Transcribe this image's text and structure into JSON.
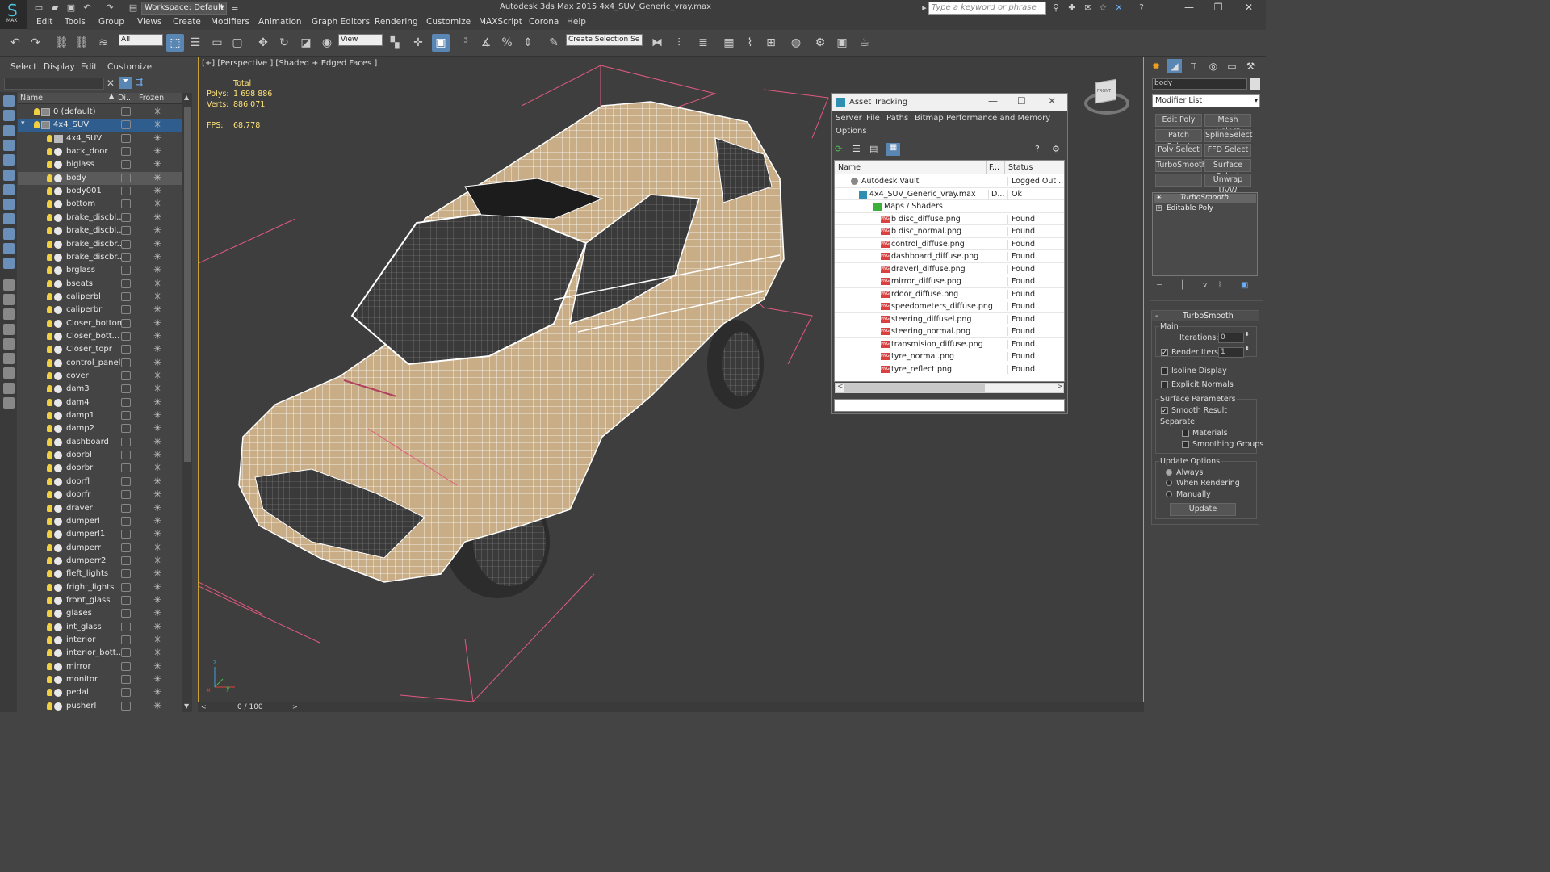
{
  "app": {
    "title": "Autodesk 3ds Max  2015    4x4_SUV_Generic_vray.max",
    "logo": "MAX",
    "workspace": "Workspace: Default",
    "search_placeholder": "Type a keyword or phrase"
  },
  "menu": [
    "Edit",
    "Tools",
    "Group",
    "Views",
    "Create",
    "Modifiers",
    "Animation",
    "Graph Editors",
    "Rendering",
    "Customize",
    "MAXScript",
    "Corona",
    "Help"
  ],
  "toolbar": {
    "filter": "All",
    "refcoord": "View",
    "selset": "Create Selection Se"
  },
  "scene": {
    "tabs": [
      "Select",
      "Display",
      "Edit",
      "Customize"
    ],
    "columns": {
      "name": "Name",
      "display": "Di...",
      "frozen": "Frozen"
    },
    "rows": [
      {
        "label": "0 (default)",
        "type": "layer"
      },
      {
        "label": "4x4_SUV",
        "type": "layer",
        "selected": true
      },
      {
        "label": "4x4_SUV",
        "type": "group"
      },
      {
        "label": "back_door"
      },
      {
        "label": "blglass"
      },
      {
        "label": "body",
        "highlight": true
      },
      {
        "label": "body001"
      },
      {
        "label": "bottom"
      },
      {
        "label": "brake_discbl..."
      },
      {
        "label": "brake_discbl..."
      },
      {
        "label": "brake_discbr..."
      },
      {
        "label": "brake_discbr..."
      },
      {
        "label": "brglass"
      },
      {
        "label": "bseats"
      },
      {
        "label": "caliperbl"
      },
      {
        "label": "caliperbr"
      },
      {
        "label": "Closer_bottoml"
      },
      {
        "label": "Closer_bott..."
      },
      {
        "label": "Closer_topr"
      },
      {
        "label": "control_panel"
      },
      {
        "label": "cover"
      },
      {
        "label": "dam3"
      },
      {
        "label": "dam4"
      },
      {
        "label": "damp1"
      },
      {
        "label": "damp2"
      },
      {
        "label": "dashboard"
      },
      {
        "label": "doorbl"
      },
      {
        "label": "doorbr"
      },
      {
        "label": "doorfl"
      },
      {
        "label": "doorfr"
      },
      {
        "label": "draver"
      },
      {
        "label": "dumperl"
      },
      {
        "label": "dumperl1"
      },
      {
        "label": "dumperr"
      },
      {
        "label": "dumperr2"
      },
      {
        "label": "fleft_lights"
      },
      {
        "label": "fright_lights"
      },
      {
        "label": "front_glass"
      },
      {
        "label": "glases"
      },
      {
        "label": "int_glass"
      },
      {
        "label": "interior"
      },
      {
        "label": "interior_bott..."
      },
      {
        "label": "mirror"
      },
      {
        "label": "monitor"
      },
      {
        "label": "pedal"
      },
      {
        "label": "pusherl"
      }
    ]
  },
  "viewport": {
    "label": "[+] [Perspective ] [Shaded + Edged Faces ]",
    "stats": {
      "total": "Total",
      "polys_label": "Polys:",
      "polys": "1 698 886",
      "verts_label": "Verts:",
      "verts": "886 071",
      "fps_label": "FPS:",
      "fps": "68,778"
    },
    "timeline": "0 / 100",
    "viewcube": "FRONT"
  },
  "asset": {
    "title": "Asset Tracking",
    "menu": [
      "Server",
      "File",
      "Paths",
      "Bitmap Performance and Memory",
      "Options"
    ],
    "columns": {
      "name": "Name",
      "f": "F...",
      "status": "Status"
    },
    "rows": [
      {
        "name": "Autodesk Vault",
        "f": "",
        "status": "Logged Out ...",
        "level": 0,
        "icon": "vault"
      },
      {
        "name": "4x4_SUV_Generic_vray.max",
        "f": "D...",
        "status": "Ok",
        "level": 1,
        "icon": "max"
      },
      {
        "name": "Maps / Shaders",
        "f": "",
        "status": "",
        "level": 2,
        "icon": "maps"
      },
      {
        "name": "b disc_diffuse.png",
        "f": "",
        "status": "Found",
        "level": 3,
        "icon": "png"
      },
      {
        "name": "b disc_normal.png",
        "f": "",
        "status": "Found",
        "level": 3,
        "icon": "png"
      },
      {
        "name": "control_diffuse.png",
        "f": "",
        "status": "Found",
        "level": 3,
        "icon": "png"
      },
      {
        "name": "dashboard_diffuse.png",
        "f": "",
        "status": "Found",
        "level": 3,
        "icon": "png"
      },
      {
        "name": "draverl_diffuse.png",
        "f": "",
        "status": "Found",
        "level": 3,
        "icon": "png"
      },
      {
        "name": "mirror_diffuse.png",
        "f": "",
        "status": "Found",
        "level": 3,
        "icon": "png"
      },
      {
        "name": "rdoor_diffuse.png",
        "f": "",
        "status": "Found",
        "level": 3,
        "icon": "png"
      },
      {
        "name": "speedometers_diffuse.png",
        "f": "",
        "status": "Found",
        "level": 3,
        "icon": "png"
      },
      {
        "name": "steering_diffusel.png",
        "f": "",
        "status": "Found",
        "level": 3,
        "icon": "png"
      },
      {
        "name": "steering_normal.png",
        "f": "",
        "status": "Found",
        "level": 3,
        "icon": "png"
      },
      {
        "name": "transmision_diffuse.png",
        "f": "",
        "status": "Found",
        "level": 3,
        "icon": "png"
      },
      {
        "name": "tyre_normal.png",
        "f": "",
        "status": "Found",
        "level": 3,
        "icon": "png"
      },
      {
        "name": "tyre_reflect.png",
        "f": "",
        "status": "Found",
        "level": 3,
        "icon": "png"
      }
    ]
  },
  "cmd": {
    "object_name": "body",
    "modifier_list": "Modifier List",
    "buttons": [
      "Edit Poly",
      "Mesh Select",
      "Patch Select",
      "SplineSelect",
      "Poly Select",
      "FFD Select",
      "TurboSmooth",
      "Surface Select",
      "",
      "Unwrap UVW"
    ],
    "stack": [
      "TurboSmooth",
      "Editable Poly"
    ],
    "rollout_title": "TurboSmooth",
    "main_label": "Main",
    "iterations_label": "Iterations:",
    "iterations": "0",
    "render_iters_label": "Render Iters:",
    "render_iters": "1",
    "isoline": "Isoline Display",
    "explicit": "Explicit Normals",
    "surface_params": "Surface Parameters",
    "smooth_result": "Smooth Result",
    "separate": "Separate",
    "materials": "Materials",
    "smoothing_groups": "Smoothing Groups",
    "update_options": "Update Options",
    "always": "Always",
    "when_rendering": "When Rendering",
    "manually": "Manually",
    "update_btn": "Update"
  },
  "colors": {
    "accent": "#5a86b4",
    "viewport_border": "#c9a233",
    "stats": "#ffe37a",
    "selected_row": "#2f5d8e"
  }
}
